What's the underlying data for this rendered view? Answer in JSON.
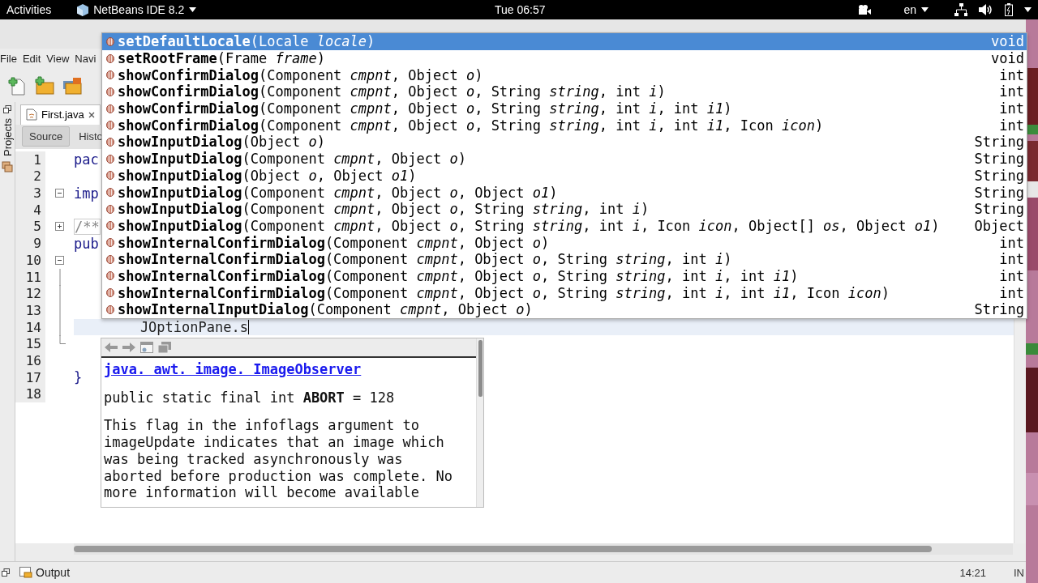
{
  "top_bar": {
    "activities": "Activities",
    "app_menu": "NetBeans IDE 8.2",
    "clock": "Tue 06:57",
    "language": "en"
  },
  "menu_bar": [
    "File",
    "Edit",
    "View",
    "Navi"
  ],
  "editor_tabs": [
    {
      "label": "First.java",
      "selected": true
    }
  ],
  "editor_views": [
    {
      "label": "Source",
      "selected": true
    },
    {
      "label": "Histo",
      "selected": false
    }
  ],
  "side_panel": {
    "label": "Projects"
  },
  "code_lines": [
    {
      "number": "1",
      "text": "pac",
      "kind": "plain",
      "current": false
    },
    {
      "number": "2",
      "kind": "plain",
      "current": false
    },
    {
      "number": "3",
      "text": "imp",
      "kind": "fold_open",
      "current": false
    },
    {
      "number": "4",
      "kind": "plain",
      "current": false
    },
    {
      "number": "5",
      "text": "/**",
      "kind": "fold_closed",
      "current": false
    },
    {
      "number": "9",
      "text": "pub",
      "kind": "plain",
      "current": false
    },
    {
      "number": "10",
      "kind": "fold_open",
      "current": false
    },
    {
      "number": "11",
      "kind": "fold_body",
      "current": false
    },
    {
      "number": "12",
      "kind": "fold_body",
      "current": false
    },
    {
      "number": "13",
      "kind": "fold_body",
      "current": false
    },
    {
      "number": "14",
      "text": "        JOptionPane.s",
      "kind": "fold_body",
      "current": true
    },
    {
      "number": "15",
      "kind": "fold_end",
      "current": false
    },
    {
      "number": "16",
      "kind": "plain",
      "current": false
    },
    {
      "number": "17",
      "text": "}",
      "kind": "plain",
      "current": false
    },
    {
      "number": "18",
      "kind": "plain",
      "current": false
    }
  ],
  "completion": [
    {
      "signature": "**setDefaultLocale**(Locale *locale*)",
      "returns": "void",
      "selected": true
    },
    {
      "signature": "**setRootFrame**(Frame *frame*)",
      "returns": "void",
      "selected": false
    },
    {
      "signature": "**showConfirmDialog**(Component *cmpnt*, Object *o*)",
      "returns": "int",
      "selected": false
    },
    {
      "signature": "**showConfirmDialog**(Component *cmpnt*, Object *o*, String *string*, int *i*)",
      "returns": "int",
      "selected": false
    },
    {
      "signature": "**showConfirmDialog**(Component *cmpnt*, Object *o*, String *string*, int *i*, int *i1*)",
      "returns": "int",
      "selected": false
    },
    {
      "signature": "**showConfirmDialog**(Component *cmpnt*, Object *o*, String *string*, int *i*, int *i1*, Icon *icon*)",
      "returns": "int",
      "selected": false
    },
    {
      "signature": "**showInputDialog**(Object *o*)",
      "returns": "String",
      "selected": false
    },
    {
      "signature": "**showInputDialog**(Component *cmpnt*, Object *o*)",
      "returns": "String",
      "selected": false
    },
    {
      "signature": "**showInputDialog**(Object *o*, Object *o1*)",
      "returns": "String",
      "selected": false
    },
    {
      "signature": "**showInputDialog**(Component *cmpnt*, Object *o*, Object *o1*)",
      "returns": "String",
      "selected": false
    },
    {
      "signature": "**showInputDialog**(Component *cmpnt*, Object *o*, String *string*, int *i*)",
      "returns": "String",
      "selected": false
    },
    {
      "signature": "**showInputDialog**(Component *cmpnt*, Object *o*, String *string*, int *i*, Icon *icon*, Object[] *os*, Object *o1*)",
      "returns": "Object",
      "selected": false
    },
    {
      "signature": "**showInternalConfirmDialog**(Component *cmpnt*, Object *o*)",
      "returns": "int",
      "selected": false
    },
    {
      "signature": "**showInternalConfirmDialog**(Component *cmpnt*, Object *o*, String *string*, int *i*)",
      "returns": "int",
      "selected": false
    },
    {
      "signature": "**showInternalConfirmDialog**(Component *cmpnt*, Object *o*, String *string*, int *i*, int *i1*)",
      "returns": "int",
      "selected": false
    },
    {
      "signature": "**showInternalConfirmDialog**(Component *cmpnt*, Object *o*, String *string*, int *i*, int *i1*, Icon *icon*)",
      "returns": "int",
      "selected": false
    },
    {
      "signature": "**showInternalInputDialog**(Component *cmpnt*, Object *o*)",
      "returns": "String",
      "selected": false
    }
  ],
  "javadoc": {
    "class_link": "java. awt. image. ImageObserver",
    "declaration": "public static final int **ABORT** = 128",
    "description": "This flag in the infoflags argument to imageUpdate indicates that an image which was being tracked asynchronously was aborted before production was complete. No more information will become available"
  },
  "status_bar": {
    "output": "Output",
    "position": "14:21",
    "mode": "IN"
  }
}
